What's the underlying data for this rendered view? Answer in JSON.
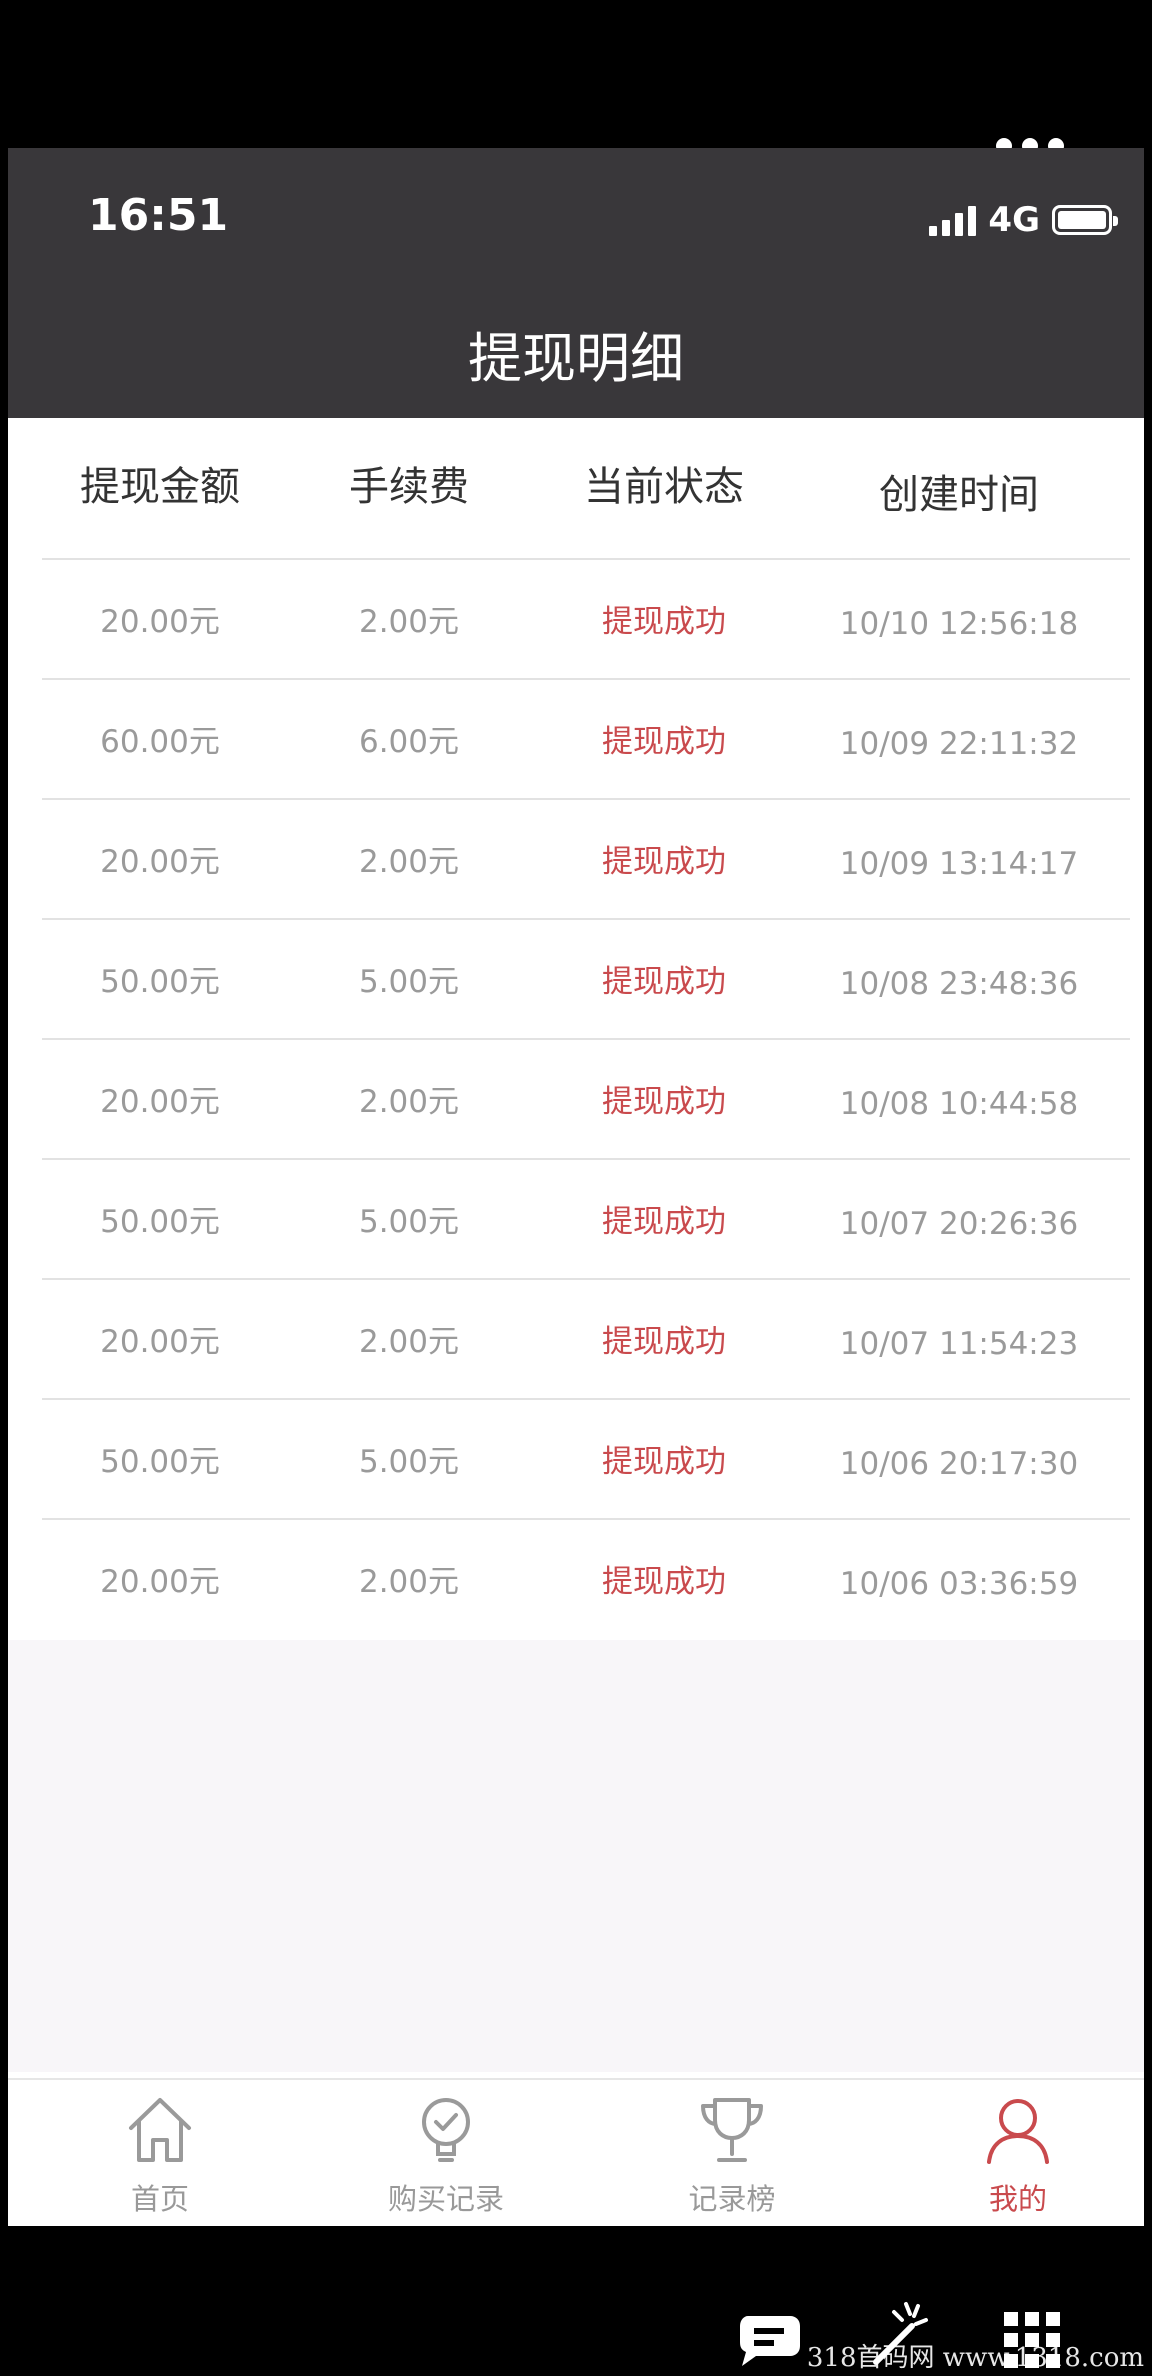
{
  "status_bar": {
    "time": "16:51",
    "network": "4G"
  },
  "header": {
    "title": "提现明细"
  },
  "table": {
    "columns": [
      "提现金额",
      "手续费",
      "当前状态",
      "创建时间"
    ],
    "rows": [
      {
        "amount": "20.00元",
        "fee": "2.00元",
        "status": "提现成功",
        "time": "10/10 12:56:18"
      },
      {
        "amount": "60.00元",
        "fee": "6.00元",
        "status": "提现成功",
        "time": "10/09 22:11:32"
      },
      {
        "amount": "20.00元",
        "fee": "2.00元",
        "status": "提现成功",
        "time": "10/09 13:14:17"
      },
      {
        "amount": "50.00元",
        "fee": "5.00元",
        "status": "提现成功",
        "time": "10/08 23:48:36"
      },
      {
        "amount": "20.00元",
        "fee": "2.00元",
        "status": "提现成功",
        "time": "10/08 10:44:58"
      },
      {
        "amount": "50.00元",
        "fee": "5.00元",
        "status": "提现成功",
        "time": "10/07 20:26:36"
      },
      {
        "amount": "20.00元",
        "fee": "2.00元",
        "status": "提现成功",
        "time": "10/07 11:54:23"
      },
      {
        "amount": "50.00元",
        "fee": "5.00元",
        "status": "提现成功",
        "time": "10/06 20:17:30"
      },
      {
        "amount": "20.00元",
        "fee": "2.00元",
        "status": "提现成功",
        "time": "10/06 03:36:59"
      }
    ]
  },
  "tabbar": {
    "items": [
      {
        "label": "首页",
        "icon": "home-icon"
      },
      {
        "label": "购买记录",
        "icon": "lightbulb-check-icon"
      },
      {
        "label": "记录榜",
        "icon": "trophy-icon"
      },
      {
        "label": "我的",
        "icon": "user-icon",
        "active": true
      }
    ]
  },
  "watermark": "318首码网 www.1318.com",
  "colors": {
    "header_bg": "#39373a",
    "status_success": "#c94a4d",
    "active_tab": "#c94a4d"
  }
}
